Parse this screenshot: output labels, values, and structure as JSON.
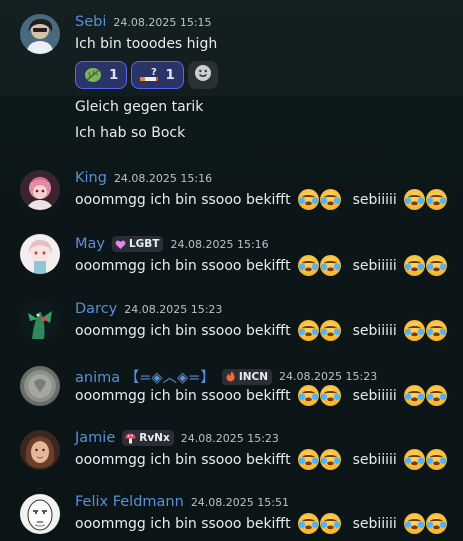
{
  "chat": {
    "messages": [
      {
        "author": "Sebi",
        "timestamp": "24.08.2025 15:15",
        "lines": [
          "Ich bin tooodes high",
          "Gleich gegen tarik",
          "Ich hab so Bock"
        ],
        "reactions": [
          {
            "icon": "herb-leaf-icon",
            "count": "1"
          },
          {
            "icon": "cigarette-question-icon",
            "count": "1"
          }
        ]
      },
      {
        "author": "King",
        "timestamp": "24.08.2025 15:16",
        "text": "ooommgg ich bin ssooo bekifft",
        "text2": "sebiiiii"
      },
      {
        "author": "May",
        "tag": "LGBT",
        "timestamp": "24.08.2025 15:16",
        "text": "ooommgg ich bin ssooo bekifft",
        "text2": "sebiiiii"
      },
      {
        "author": "Darcy",
        "timestamp": "24.08.2025 15:23",
        "text": "ooommgg ich bin ssooo bekifft",
        "text2": "sebiiiii"
      },
      {
        "author": "anima 【=◈︿◈=】",
        "tag": "INCN",
        "timestamp": "24.08.2025 15:23",
        "text": "ooommgg ich bin ssooo bekifft",
        "text2": "sebiiiii"
      },
      {
        "author": "Jamie",
        "tag": "RvNx",
        "timestamp": "24.08.2025 15:23",
        "text": "ooommgg ich bin ssooo bekifft",
        "text2": "sebiiiii"
      },
      {
        "author": "Felix Feldmann",
        "timestamp": "24.08.2025 15:51",
        "text": "ooommgg ich bin ssooo bekifft",
        "text2": "sebiiiii"
      }
    ],
    "emoji": "loudly-crying-face-icon",
    "colors": {
      "username": "#5b8fd6",
      "reaction_bg": "#2b3467",
      "reaction_border": "#5865f2",
      "background": "#0c1618"
    }
  }
}
